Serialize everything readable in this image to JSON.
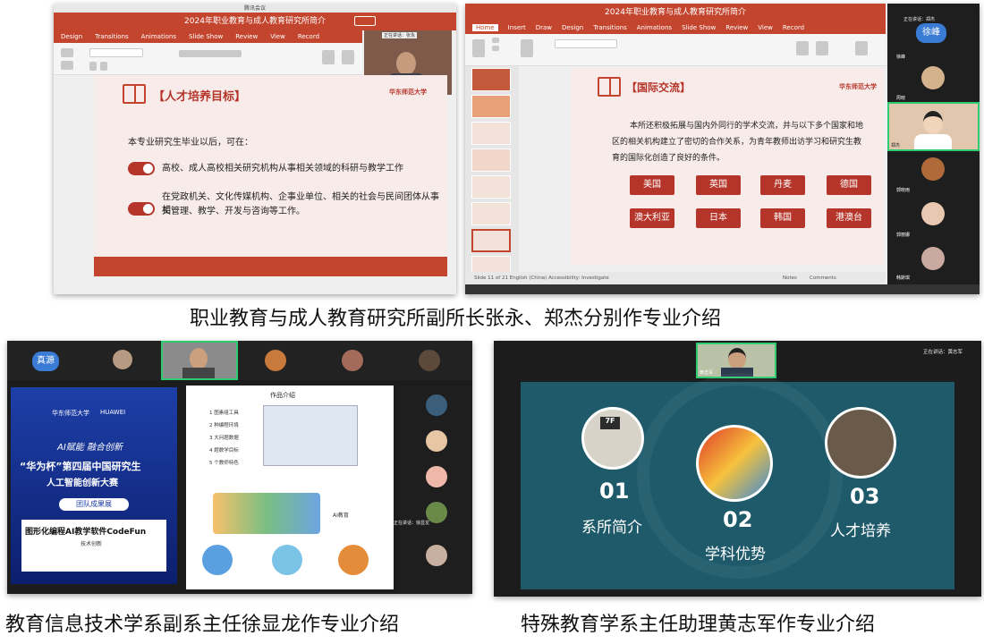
{
  "panel_tl": {
    "window_title": "腾讯会议",
    "ppt_title": "2024年职业教育与成人教育研究所简介",
    "menu": [
      "Design",
      "Transitions",
      "Animations",
      "Slide Show",
      "Review",
      "View",
      "Record"
    ],
    "speaking_label": "正在讲话：张永",
    "speaker_name": "张永",
    "slide_heading": "【人才培养目标】",
    "logo_text": "华东师范大学",
    "intro": "本专业研究生毕业以后，可在：",
    "item1": "高校、成人高校相关研究机构从事相关领域的科研与教学工作",
    "item2_line1": "在党政机关、文化传媒机构、企事业单位、相关的社会与民间团体从事相",
    "item2_line2": "关管理、教学、开发与咨询等工作。"
  },
  "panel_tr": {
    "ppt_title": "2024年职业教育与成人教育研究所简介",
    "menu": [
      "Home",
      "Insert",
      "Draw",
      "Design",
      "Transitions",
      "Animations",
      "Slide Show",
      "Review",
      "View",
      "Record"
    ],
    "speaking_label": "正在讲话：郑杰",
    "slide_heading": "【国际交流】",
    "logo_text": "华东师范大学",
    "body_line1": "本所还积极拓展与国内外同行的学术交流，并与以下多个国家和地",
    "body_line2": "区的相关机构建立了密切的合作关系，为青年教师出访学习和研究生教",
    "body_line3": "育的国际化创造了良好的条件。",
    "countries": [
      "美国",
      "英国",
      "丹麦",
      "德国",
      "澳大利亚",
      "日本",
      "韩国",
      "港澳台"
    ],
    "status_left": "Slide 11 of 21   English (China)   Accessibility: Investigate",
    "status_notes": "Notes",
    "status_comments": "Comments",
    "participant_top": "徐峰",
    "participants": [
      "徐峰",
      "周晓",
      "郑杰",
      "郭晓雨",
      "郭丽娜",
      "韩斯琪"
    ]
  },
  "caption_top": "职业教育与成人教育研究所副所长张永、郑杰分别作专业介绍",
  "panel_bl": {
    "avatar_text": "真源",
    "poster_logo": "华东师范大学",
    "poster_brand": "HUAWEI",
    "poster_line1": "AI赋能 融合创新",
    "poster_line2": "“华为杯”第四届中国研究生",
    "poster_line3": "人工智能创新大赛",
    "poster_badge": "团队成果展",
    "poster_title": "图形化编程AI教学软件CodeFun",
    "poster_sub": "技术创新",
    "doc_title": "作品介绍",
    "features": [
      "1 图素组工具",
      "2 种编程环境",
      "3 大问题数据",
      "4 题数学目标",
      "5 个教师特色"
    ],
    "ai_label": "AI教育",
    "speaking_label": "正在讲话：徐显龙"
  },
  "panel_br": {
    "speaker": "黄志军",
    "speaking_label": "正在讲话：黄志军",
    "items": [
      {
        "num": "01",
        "label": "系所简介"
      },
      {
        "num": "02",
        "label": "学科优势"
      },
      {
        "num": "03",
        "label": "人才培养"
      }
    ],
    "thumb_sign": "7F"
  },
  "caption_bl": "教育信息技术学系副系主任徐显龙作专业介绍",
  "caption_br": "特殊教育学系主任助理黄志军作专业介绍"
}
